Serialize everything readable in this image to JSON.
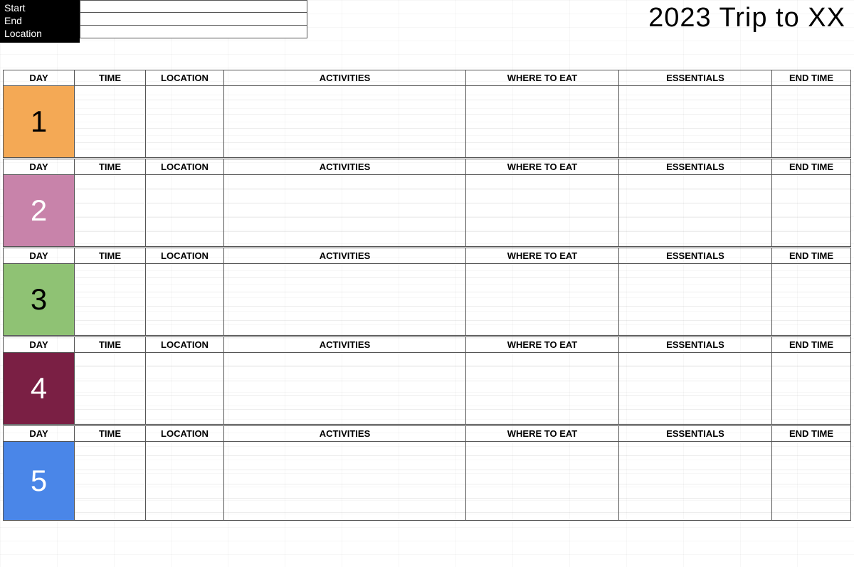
{
  "meta": {
    "labels": {
      "start": "Start",
      "end": "End",
      "location": "Location"
    },
    "values": {
      "start": "",
      "end": "",
      "location": ""
    }
  },
  "title": "2023 Trip to XX",
  "columns": {
    "day": "DAY",
    "time": "TIME",
    "location": "LOCATION",
    "activities": "ACTIVITIES",
    "where_to_eat": "WHERE TO EAT",
    "essentials": "ESSENTIALS",
    "end_time": "END TIME"
  },
  "days": [
    {
      "num": "1",
      "color": "#f4a955",
      "text": "dark"
    },
    {
      "num": "2",
      "color": "#c883aa",
      "text": "light"
    },
    {
      "num": "3",
      "color": "#8fc274",
      "text": "dark"
    },
    {
      "num": "4",
      "color": "#7a1f44",
      "text": "light"
    },
    {
      "num": "5",
      "color": "#4a86e8",
      "text": "light"
    }
  ]
}
